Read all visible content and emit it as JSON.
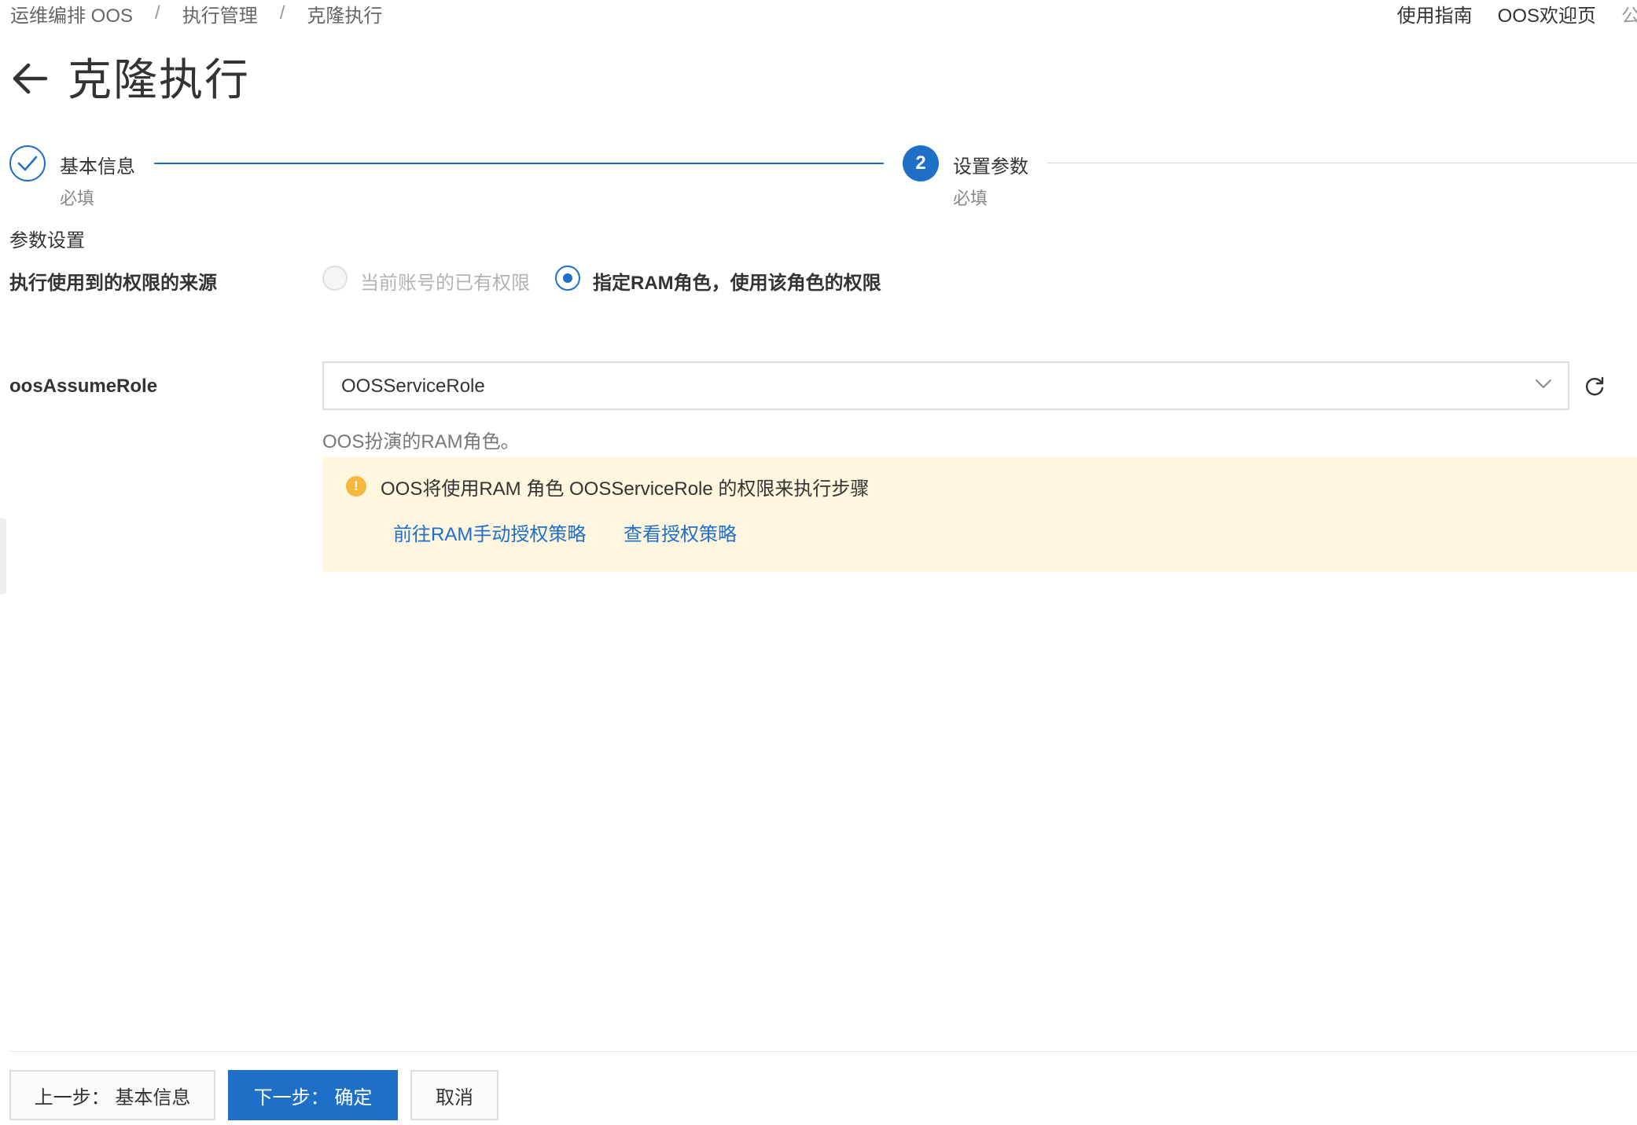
{
  "breadcrumb": {
    "items": [
      "运维编排 OOS",
      "执行管理",
      "克隆执行"
    ],
    "separator": "/"
  },
  "top_links": {
    "guide": "使用指南",
    "welcome": "OOS欢迎页",
    "cut_off": "公"
  },
  "header": {
    "back_icon": "arrow-left-icon",
    "title": "克隆执行"
  },
  "steps": [
    {
      "number": "1",
      "title": "基本信息",
      "desc": "必填",
      "status": "done",
      "icon": "check-icon"
    },
    {
      "number": "2",
      "title": "设置参数",
      "desc": "必填",
      "status": "current"
    }
  ],
  "form": {
    "section_title": "参数设置",
    "permission": {
      "label": "执行使用到的权限的来源",
      "options": [
        {
          "label": "当前账号的已有权限",
          "state": "disabled"
        },
        {
          "label": "指定RAM角色，使用该角色的权限",
          "state": "checked"
        }
      ]
    },
    "role": {
      "label": "oosAssumeRole",
      "value": "OOSServiceRole",
      "help": "OOS扮演的RAM角色。",
      "refresh_icon": "refresh-icon"
    },
    "notice": {
      "icon": "warning-icon",
      "icon_glyph": "!",
      "text": "OOS将使用RAM 角色 OOSServiceRole 的权限来执行步骤",
      "links": [
        "前往RAM手动授权策略",
        "查看授权策略"
      ]
    }
  },
  "footer": {
    "prev": "上一步： 基本信息",
    "next": "下一步： 确定",
    "cancel": "取消"
  },
  "colors": {
    "primary": "#1d6fc8",
    "notice_bg": "#fff6df",
    "warning": "#f5b83d"
  }
}
